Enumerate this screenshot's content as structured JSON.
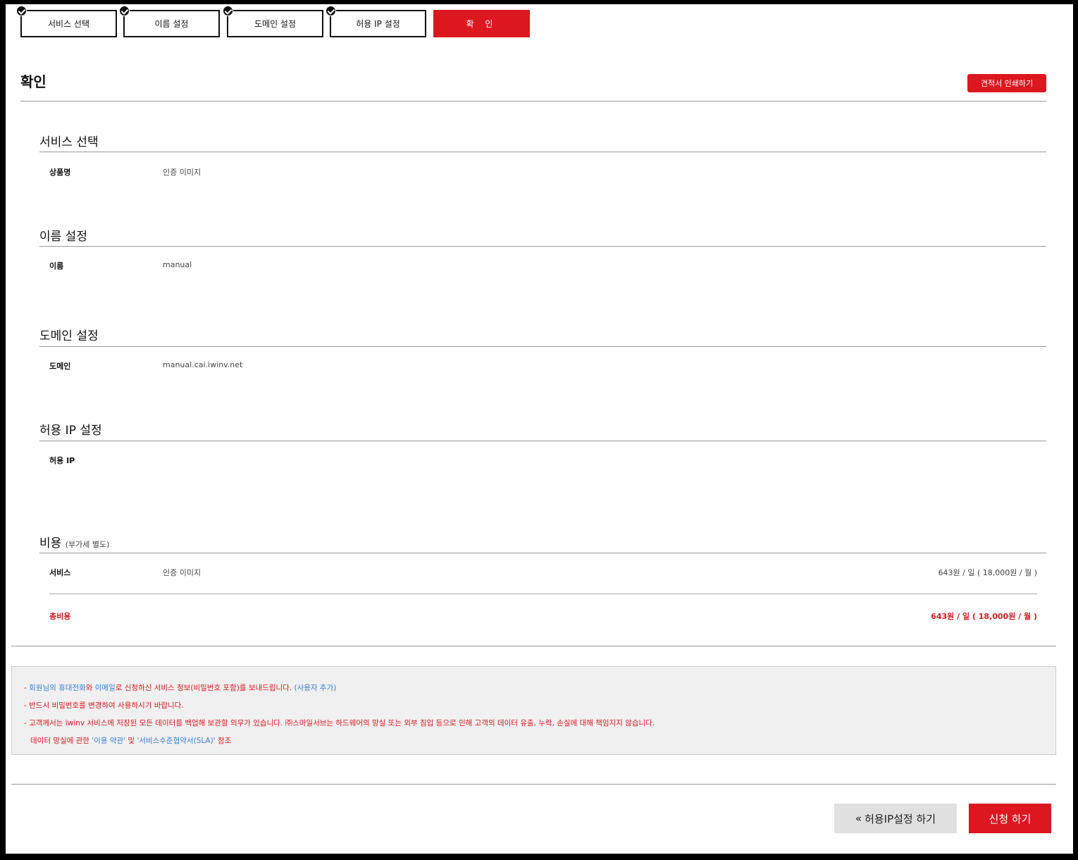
{
  "steps": [
    {
      "label": "서비스 선택",
      "completed": true
    },
    {
      "label": "이름 설정",
      "completed": true
    },
    {
      "label": "도메인 설정",
      "completed": true
    },
    {
      "label": "허용 IP 설정",
      "completed": true
    },
    {
      "label": "확 인",
      "completed": false,
      "active": true
    }
  ],
  "header": {
    "title": "확인",
    "print_button": "견적서 인쇄하기"
  },
  "sections": {
    "service": {
      "title": "서비스 선택",
      "label": "상품명",
      "value": "인증 이미지"
    },
    "name": {
      "title": "이름 설정",
      "label": "이름",
      "value": "manual"
    },
    "domain": {
      "title": "도메인 설정",
      "label": "도메인",
      "value": "manual.cai.iwinv.net"
    },
    "ip": {
      "title": "허용 IP 설정",
      "label": "허용 IP",
      "value": ""
    },
    "cost": {
      "title": "비용",
      "subtitle": "(부가세 별도)",
      "service_label": "서비스",
      "service_value": "인증 이미지",
      "service_price": "643원 / 일 ( 18,000원 / 월 )",
      "total_label": "총비용",
      "total_price": "643원 / 일 ( 18,000원 / 월 )"
    }
  },
  "notice": {
    "line1_prefix": "- ",
    "line1_blue1": "회원님의 휴대전화",
    "line1_mid1": "와 ",
    "line1_blue2": "이메일",
    "line1_mid2": "로 신청하신 서비스 정보(비밀번호 포함)를 보내드립니다. ",
    "line1_link": "(사용자 추가)",
    "line2": "- 반드시 비밀번호를 변경하여 사용하시기 바랍니다.",
    "line3": "- 고객께서는 iwinv 서비스에 저장된 모든 데이터를 백업해 보관할 의무가 있습니다. ㈜스마일서브는 하드웨어의 망실 또는 외부 침입 등으로 인해 고객의 데이터 유출, 누락, 손실에 대해 책임지지 않습니다.",
    "line4_prefix": "데이터 망실에 관한 ",
    "line4_link1": "'이용 약관'",
    "line4_mid": " 및 ",
    "line4_link2": "'서비스수준협약서(SLA)'",
    "line4_suffix": " 참조"
  },
  "footer": {
    "back_button": "허용IP설정 하기",
    "submit_button": "신청 하기"
  },
  "colors": {
    "accent": "#dc1720",
    "link": "#3a7bd5"
  }
}
